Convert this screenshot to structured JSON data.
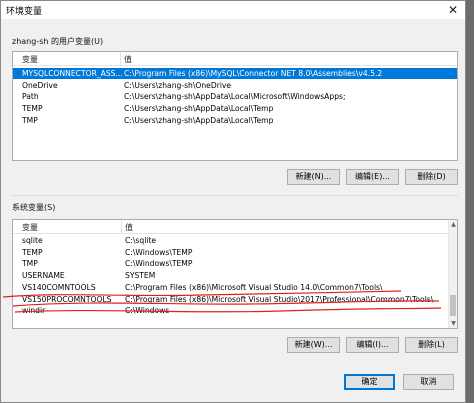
{
  "window": {
    "title": "环境变量",
    "close_glyph": "✕"
  },
  "user_vars": {
    "group_label": "zhang-sh 的用户变量(U)",
    "columns": [
      "变量",
      "值"
    ],
    "rows": [
      {
        "name": "MYSQLCONNECTOR_ASS...",
        "value": "C:\\Program Files (x86)\\MySQL\\Connector NET 8.0\\Assemblies\\v4.5.2",
        "selected": true
      },
      {
        "name": "OneDrive",
        "value": "C:\\Users\\zhang-sh\\OneDrive"
      },
      {
        "name": "Path",
        "value": "C:\\Users\\zhang-sh\\AppData\\Local\\Microsoft\\WindowsApps;"
      },
      {
        "name": "TEMP",
        "value": "C:\\Users\\zhang-sh\\AppData\\Local\\Temp"
      },
      {
        "name": "TMP",
        "value": "C:\\Users\\zhang-sh\\AppData\\Local\\Temp"
      }
    ],
    "buttons": {
      "new": "新建(N)...",
      "edit": "编辑(E)...",
      "delete": "删除(D)"
    }
  },
  "system_vars": {
    "group_label": "系统变量(S)",
    "columns": [
      "变量",
      "值"
    ],
    "rows": [
      {
        "name": "sqlite",
        "value": "C:\\sqlite"
      },
      {
        "name": "TEMP",
        "value": "C:\\Windows\\TEMP"
      },
      {
        "name": "TMP",
        "value": "C:\\Windows\\TEMP"
      },
      {
        "name": "USERNAME",
        "value": "SYSTEM"
      },
      {
        "name": "VS140COMNTOOLS",
        "value": "C:\\Program Files (x86)\\Microsoft Visual Studio 14.0\\Common7\\Tools\\"
      },
      {
        "name": "VS150PROCOMNTOOLS",
        "value": "C:\\Program Files (x86)\\Microsoft Visual Studio\\2017\\Professional\\Common7\\Tools\\"
      },
      {
        "name": "windir",
        "value": "C:\\Windows"
      }
    ],
    "buttons": {
      "new": "新建(W)...",
      "edit": "编辑(I)...",
      "delete": "删除(L)"
    }
  },
  "footer": {
    "ok": "确定",
    "cancel": "取消"
  },
  "colors": {
    "selection": "#0078d7",
    "annotation": "#e0201c"
  }
}
